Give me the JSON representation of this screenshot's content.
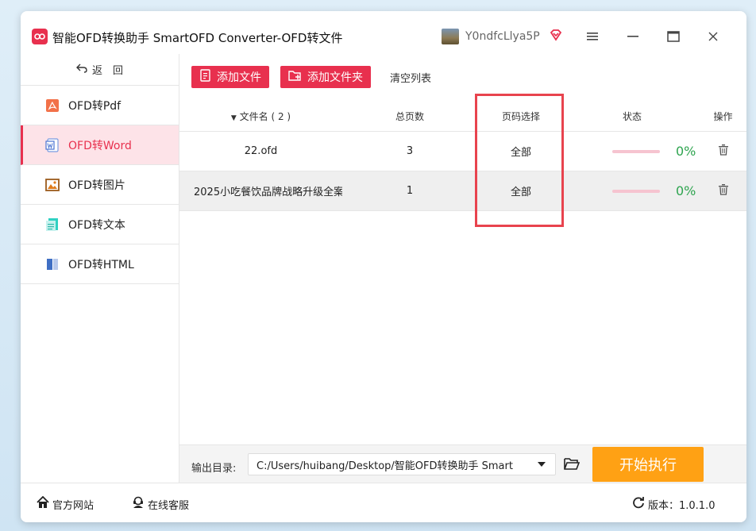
{
  "window": {
    "title": "智能OFD转换助手 SmartOFD Converter-OFD转文件",
    "username": "Y0ndfcLlya5P"
  },
  "nav": {
    "back_label": "返　回",
    "items": [
      {
        "label": "OFD转Pdf",
        "icon": "pdf-icon"
      },
      {
        "label": "OFD转Word",
        "icon": "word-icon",
        "active": true
      },
      {
        "label": "OFD转图片",
        "icon": "image-icon"
      },
      {
        "label": "OFD转文本",
        "icon": "text-icon"
      },
      {
        "label": "OFD转HTML",
        "icon": "html-icon"
      }
    ]
  },
  "toolbar": {
    "add_file": "添加文件",
    "add_folder": "添加文件夹",
    "clear_list": "清空列表"
  },
  "table": {
    "headers": {
      "name": "文件名 ( 2 )",
      "pages": "总页数",
      "range": "页码选择",
      "status": "状态",
      "op": "操作"
    },
    "rows": [
      {
        "name": "22.ofd",
        "pages": "3",
        "range": "全部",
        "progress": "0%"
      },
      {
        "name": "2025小吃餐饮品牌战略升级全案...",
        "pages": "1",
        "range": "全部",
        "progress": "0%"
      }
    ]
  },
  "output": {
    "label": "输出目录:",
    "path": "C:/Users/huibang/Desktop/智能OFD转换助手 Smart",
    "start": "开始执行"
  },
  "footer": {
    "website": "官方网站",
    "support": "在线客服",
    "version": "版本：1.0.1.0"
  },
  "colors": {
    "accent": "#e8304e",
    "start": "#ffa114",
    "progress_text": "#2ea44f"
  }
}
